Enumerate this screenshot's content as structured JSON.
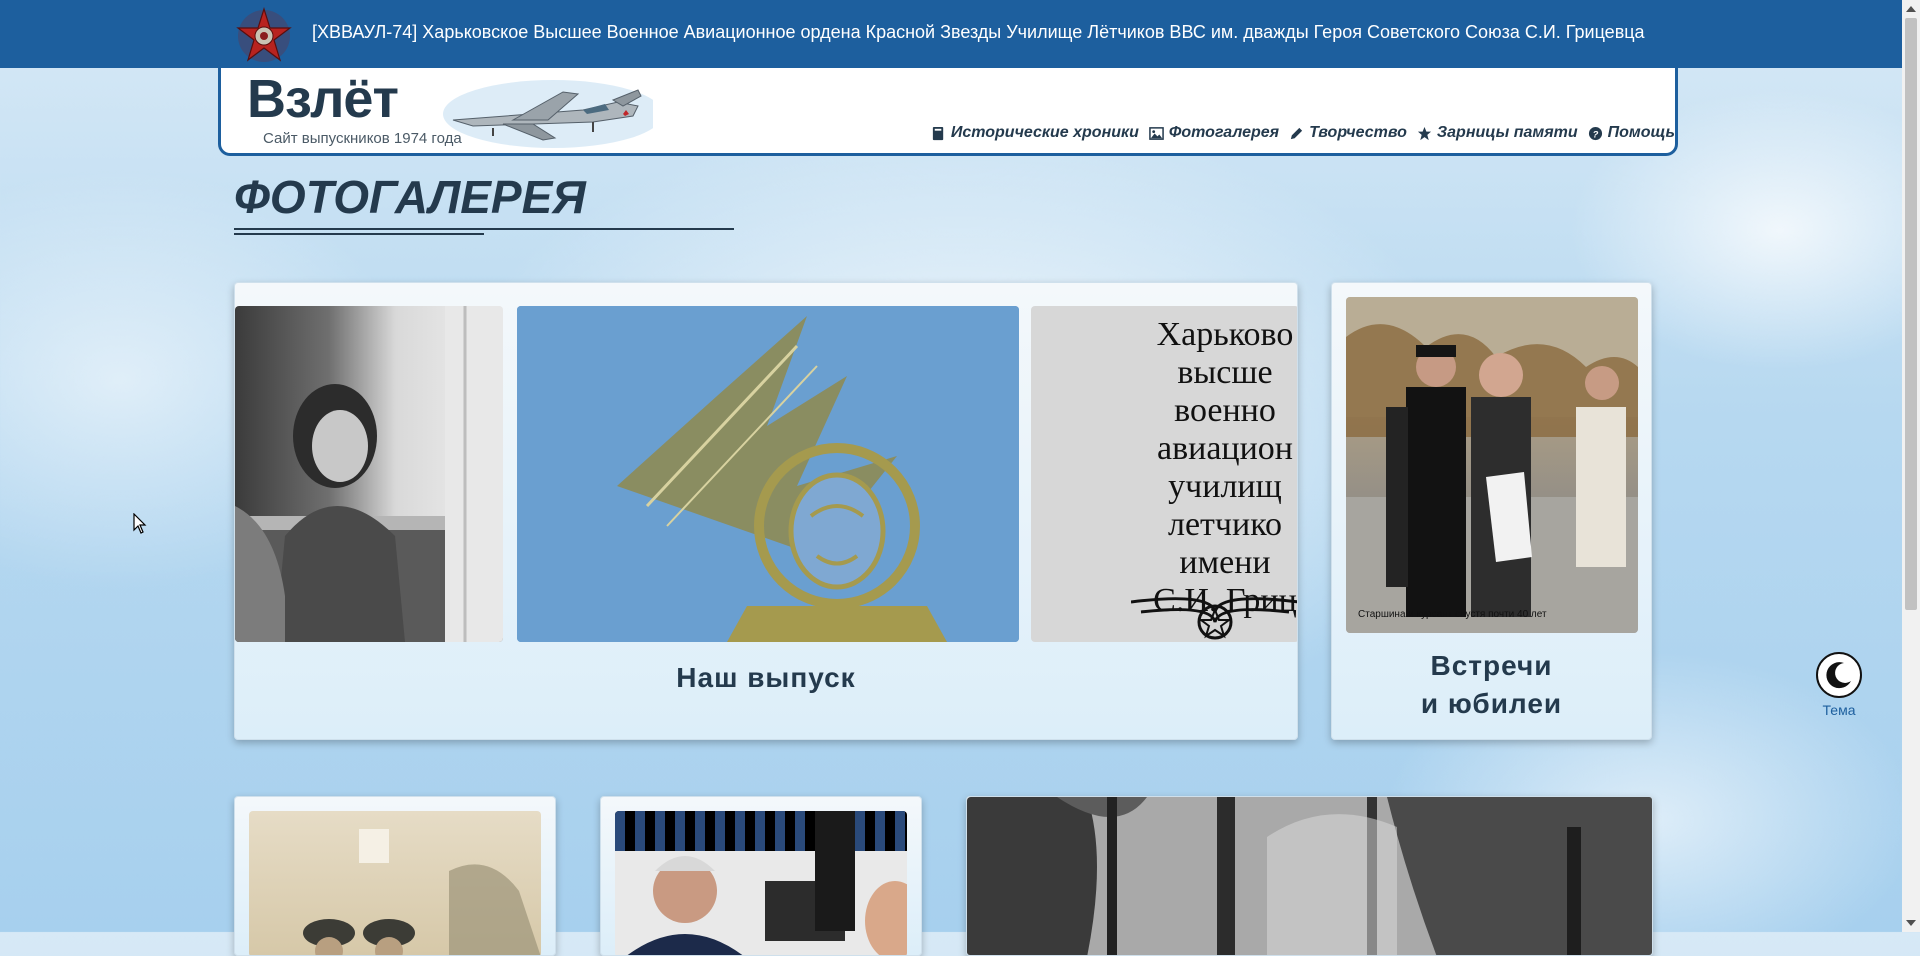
{
  "topbar": {
    "title": "[ХВВАУЛ-74] Харьковское Высшее Военное Авиационное ордена Красной Звезды Училище Лётчиков ВВС им. дважды Героя Советского Союза С.И. Грицевца",
    "emblem_icon": "red-star-order-icon",
    "background_color": "#1d5f9e"
  },
  "header": {
    "logo": "Взлёт",
    "subtitle": "Сайт выпускников 1974 года",
    "nav": [
      {
        "label": "Исторические хроники",
        "icon": "book-icon"
      },
      {
        "label": "Фотогалерея",
        "icon": "image-icon"
      },
      {
        "label": "Творчество",
        "icon": "pencil-icon"
      },
      {
        "label": "Зарницы памяти",
        "icon": "star-icon"
      },
      {
        "label": "Помощь",
        "icon": "question-circle-icon"
      }
    ]
  },
  "page": {
    "title": "ФОТОГАЛЕРЕЯ"
  },
  "cards": {
    "class_of": {
      "label": "Наш выпуск",
      "cover_text": [
        "Харьково",
        "высше",
        "военно",
        "авиацион",
        "училищ",
        "летчико",
        "имени",
        "С.И. Гриц"
      ]
    },
    "meetings": {
      "label_line1": "Встречи",
      "label_line2": "и юбилеи",
      "photo_caption": "Старшина и курсант спустя почти 40 лет"
    }
  },
  "theme": {
    "label": "Тема",
    "icon": "moon-icon"
  },
  "colors": {
    "accent": "#1d5f9e",
    "text_dark": "#243a4d"
  }
}
